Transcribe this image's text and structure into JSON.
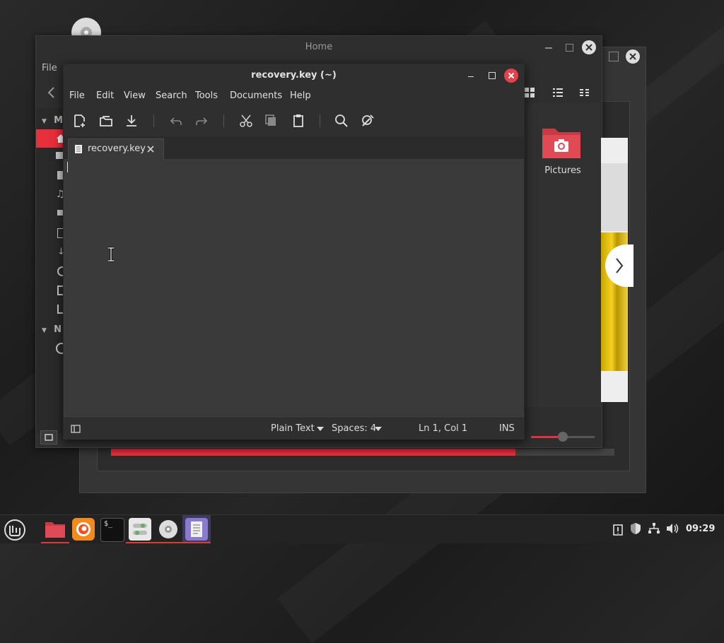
{
  "file_manager": {
    "title": "Home",
    "menu_file": "File",
    "sidebar_my_label": "M",
    "sidebar_network_label": "N",
    "folder_pictures_label": "Pictures"
  },
  "editor": {
    "title": "recovery.key (~)",
    "menu": [
      "File",
      "Edit",
      "View",
      "Search",
      "Tools",
      "Documents",
      "Help"
    ],
    "tab_label": "recovery.key",
    "content": "",
    "status": {
      "language": "Plain Text",
      "spaces": "Spaces: 4",
      "position": "Ln 1, Col 1",
      "mode": "INS"
    }
  },
  "taskbar": {
    "clock": "09:29"
  },
  "colors": {
    "accent": "#e82f3c",
    "close_button": "#e6404a",
    "folder": "#e04a55"
  }
}
